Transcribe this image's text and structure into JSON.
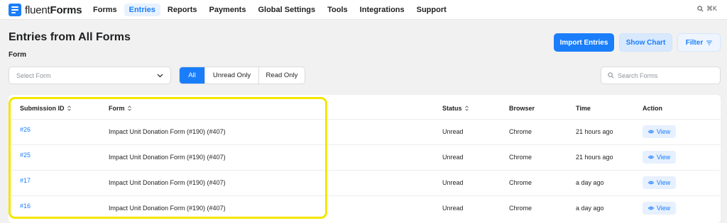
{
  "brand": {
    "name_prefix": "fluent",
    "name_suffix": "Forms",
    "accent": "#1a7efb"
  },
  "nav": {
    "items": [
      {
        "label": "Forms",
        "active": false
      },
      {
        "label": "Entries",
        "active": true
      },
      {
        "label": "Reports",
        "active": false
      },
      {
        "label": "Payments",
        "active": false
      },
      {
        "label": "Global Settings",
        "active": false
      },
      {
        "label": "Tools",
        "active": false
      },
      {
        "label": "Integrations",
        "active": false
      },
      {
        "label": "Support",
        "active": false
      }
    ],
    "shortcut": "⌘K"
  },
  "page": {
    "title": "Entries from All Forms",
    "form_label": "Form",
    "buttons": {
      "import": "Import Entries",
      "chart": "Show Chart",
      "filter": "Filter"
    }
  },
  "filters": {
    "select_form_placeholder": "Select Form",
    "tabs": [
      {
        "label": "All",
        "active": true
      },
      {
        "label": "Unread Only",
        "active": false
      },
      {
        "label": "Read Only",
        "active": false
      }
    ],
    "search_placeholder": "Search Forms"
  },
  "table": {
    "headers": {
      "submission_id": "Submission ID",
      "form": "Form",
      "status": "Status",
      "browser": "Browser",
      "time": "Time",
      "action": "Action"
    },
    "rows": [
      {
        "id": "#26",
        "form": "Impact Unit Donation Form (#190) (#407)",
        "status": "Unread",
        "browser": "Chrome",
        "time": "21 hours ago",
        "action": "View"
      },
      {
        "id": "#25",
        "form": "Impact Unit Donation Form (#190) (#407)",
        "status": "Unread",
        "browser": "Chrome",
        "time": "21 hours ago",
        "action": "View"
      },
      {
        "id": "#17",
        "form": "Impact Unit Donation Form (#190) (#407)",
        "status": "Unread",
        "browser": "Chrome",
        "time": "a day ago",
        "action": "View"
      },
      {
        "id": "#16",
        "form": "Impact Unit Donation Form (#190) (#407)",
        "status": "Unread",
        "browser": "Chrome",
        "time": "a day ago",
        "action": "View"
      }
    ]
  },
  "annotation": {
    "highlight_color": "#f3e600"
  }
}
